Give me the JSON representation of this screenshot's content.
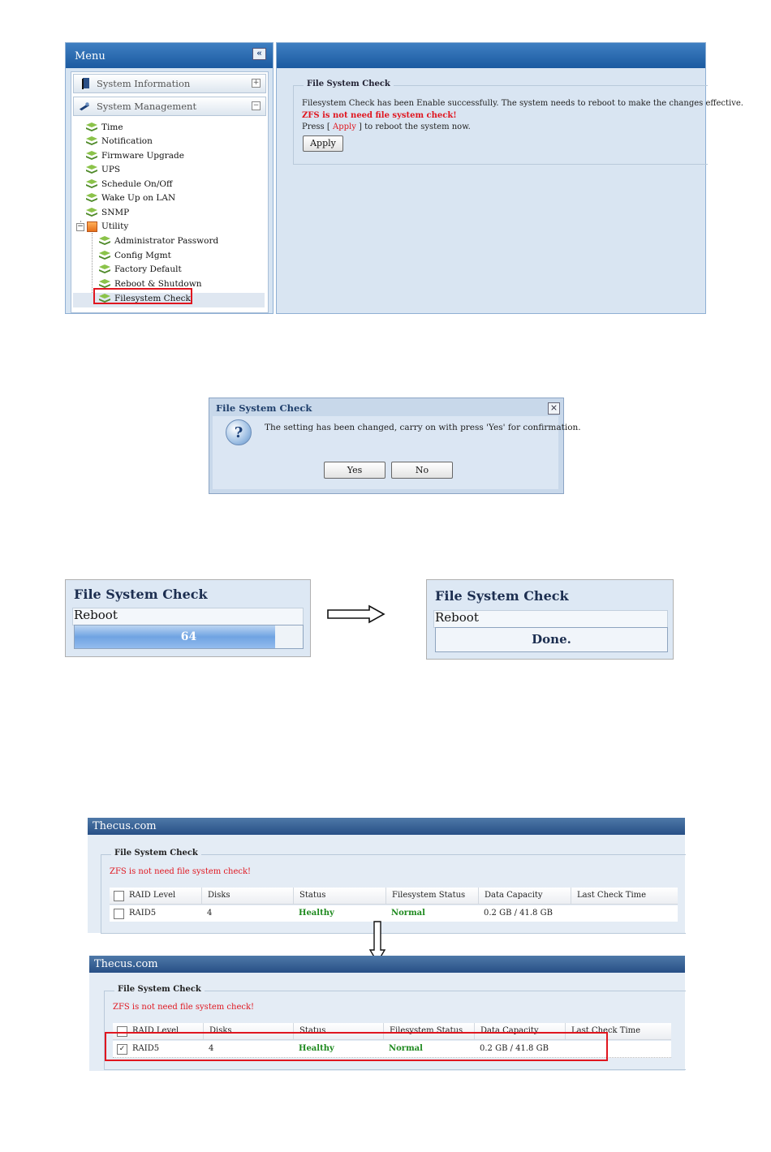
{
  "screen1": {
    "menu": {
      "title": "Menu",
      "collapse_symbol": "«",
      "sections": [
        {
          "label": "System Information",
          "toggle": "+",
          "icon": "book-icon"
        },
        {
          "label": "System Management",
          "toggle": "−",
          "icon": "wrench-icon"
        }
      ],
      "items": [
        "Time",
        "Notification",
        "Firmware Upgrade",
        "UPS",
        "Schedule On/Off",
        "Wake Up on LAN",
        "SNMP"
      ],
      "utility": {
        "label": "Utility",
        "expander": "−",
        "children": [
          "Administrator Password",
          "Config Mgmt",
          "Factory Default",
          "Reboot & Shutdown",
          "Filesystem Check"
        ]
      },
      "selected": "Filesystem Check"
    },
    "panel": {
      "legend": "File System Check",
      "message": "Filesystem Check has been Enable successfully. The system needs to reboot to make the changes effective.",
      "warning": "ZFS is not need file system check!",
      "press_prefix": "Press [",
      "press_link": "Apply",
      "press_suffix": "] to reboot the system now.",
      "apply_label": "Apply"
    }
  },
  "dialog": {
    "title": "File System Check",
    "close_symbol": "×",
    "message": "The setting has been changed, carry on with press 'Yes' for confirmation.",
    "yes_label": "Yes",
    "no_label": "No",
    "icon": "question-icon"
  },
  "progress": {
    "before": {
      "title": "File System Check",
      "subtitle": "Reboot",
      "value": 64,
      "value_label": "64",
      "fill_fraction": 0.88
    },
    "after": {
      "title": "File System Check",
      "subtitle": "Reboot",
      "done_label": "Done."
    }
  },
  "tables": [
    {
      "brand": "Thecus.com",
      "legend": "File System Check",
      "warning": "ZFS is not need file system check!",
      "columns": [
        "RAID Level",
        "Disks",
        "Status",
        "Filesystem Status",
        "Data Capacity",
        "Last Check Time"
      ],
      "rows": [
        {
          "checked": false,
          "raid_level": "RAID5",
          "disks": "4",
          "status": "Healthy",
          "fs_status": "Normal",
          "capacity": "0.2 GB / 41.8 GB",
          "last_check": ""
        }
      ]
    },
    {
      "brand": "Thecus.com",
      "legend": "File System Check",
      "warning": "ZFS is not need file system check!",
      "columns": [
        "RAID Level",
        "Disks",
        "Status",
        "Filesystem Status",
        "Data Capacity",
        "Last Check Time"
      ],
      "rows": [
        {
          "checked": true,
          "check_mark": "✓",
          "raid_level": "RAID5",
          "disks": "4",
          "status": "Healthy",
          "fs_status": "Normal",
          "capacity": "0.2 GB / 41.8 GB",
          "last_check": ""
        }
      ]
    }
  ],
  "colors": {
    "accent_blue": "#1b5aa0",
    "highlight_red": "#e0161f",
    "status_green": "#1f8a1f"
  }
}
